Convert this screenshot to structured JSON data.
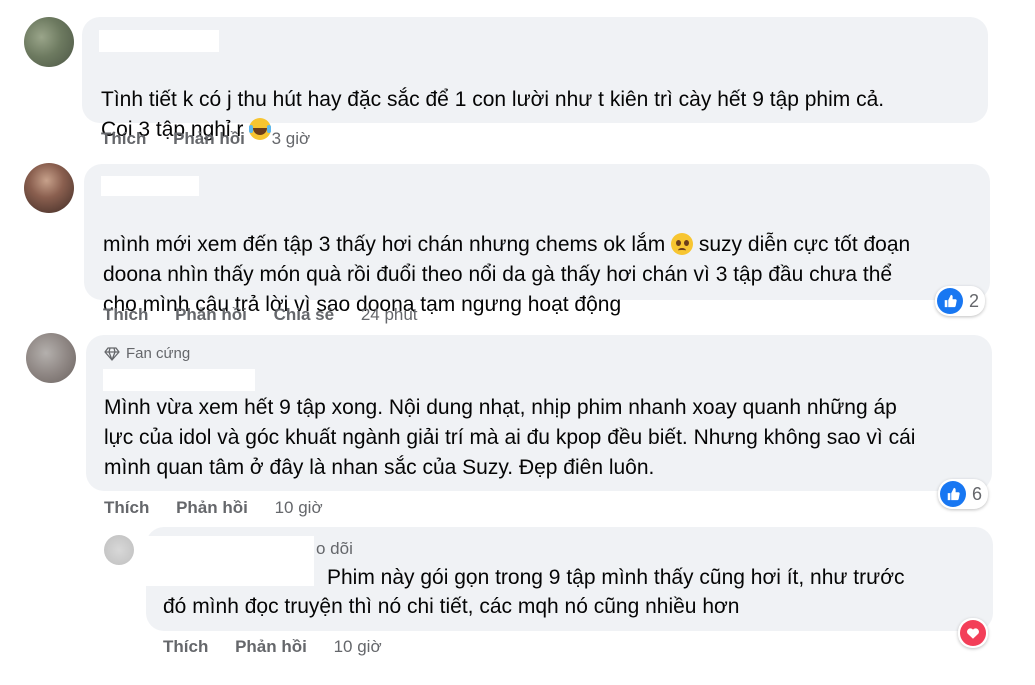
{
  "comments": [
    {
      "text": "Tình tiết k có j thu hút hay đặc sắc để 1 con lười như t kiên trì cày hết 9 tập phim cả.\nCoi 3 tập nghỉ r",
      "emoji": "laughing-tears-icon",
      "actions": {
        "like": "Thích",
        "reply": "Phản hồi"
      },
      "time": "3 giờ"
    },
    {
      "text_1": "mình mới xem đến tập 3 thấy hơi chán nhưng chems ok lắm",
      "emoji": "pleading-face-icon",
      "text_2": " suzy diễn cực tốt đoạn\ndoona nhìn thấy món quà rồi đuổi theo nổi da gà",
      "text_3": " thấy hơi chán vì 3 tập đầu chưa thể\ncho mình câu trả lời vì sao doona tạm ngưng hoạt động",
      "actions": {
        "like": "Thích",
        "reply": "Phản hồi",
        "share": "Chia sẻ"
      },
      "time": "24 phút",
      "reaction": {
        "icon": "like-icon",
        "count": "2"
      }
    },
    {
      "badge": "Fan cứng",
      "badge_icon": "diamond-icon",
      "text": "Mình vừa xem hết 9 tập xong. Nội dung nhạt, nhịp phim nhanh xoay quanh những áp\nlực của idol và góc khuất ngành giải trí mà ai đu kpop đều biết. Nhưng không sao vì cái\nmình quan tâm ở đây là nhan sắc của Suzy. Đẹp điên luôn.",
      "actions": {
        "like": "Thích",
        "reply": "Phản hồi"
      },
      "time": "10 giờ",
      "reaction": {
        "icon": "like-icon",
        "count": "6"
      }
    }
  ],
  "reply": {
    "name_fragment": "o dõi",
    "text_first": "Phim này gói gọn trong 9 tập mình thấy cũng hơi ít, như trước",
    "text_second": "đó mình đọc truyện thì nó chi tiết, các mqh nó cũng nhiều hơn",
    "actions": {
      "like": "Thích",
      "reply": "Phản hồi"
    },
    "time": "10 giờ",
    "reaction": {
      "icon": "love-icon"
    }
  },
  "colors": {
    "bubble": "#f0f2f5",
    "meta_text": "#65676b",
    "like_blue": "#1877f2",
    "love_red": "#f33e58"
  }
}
